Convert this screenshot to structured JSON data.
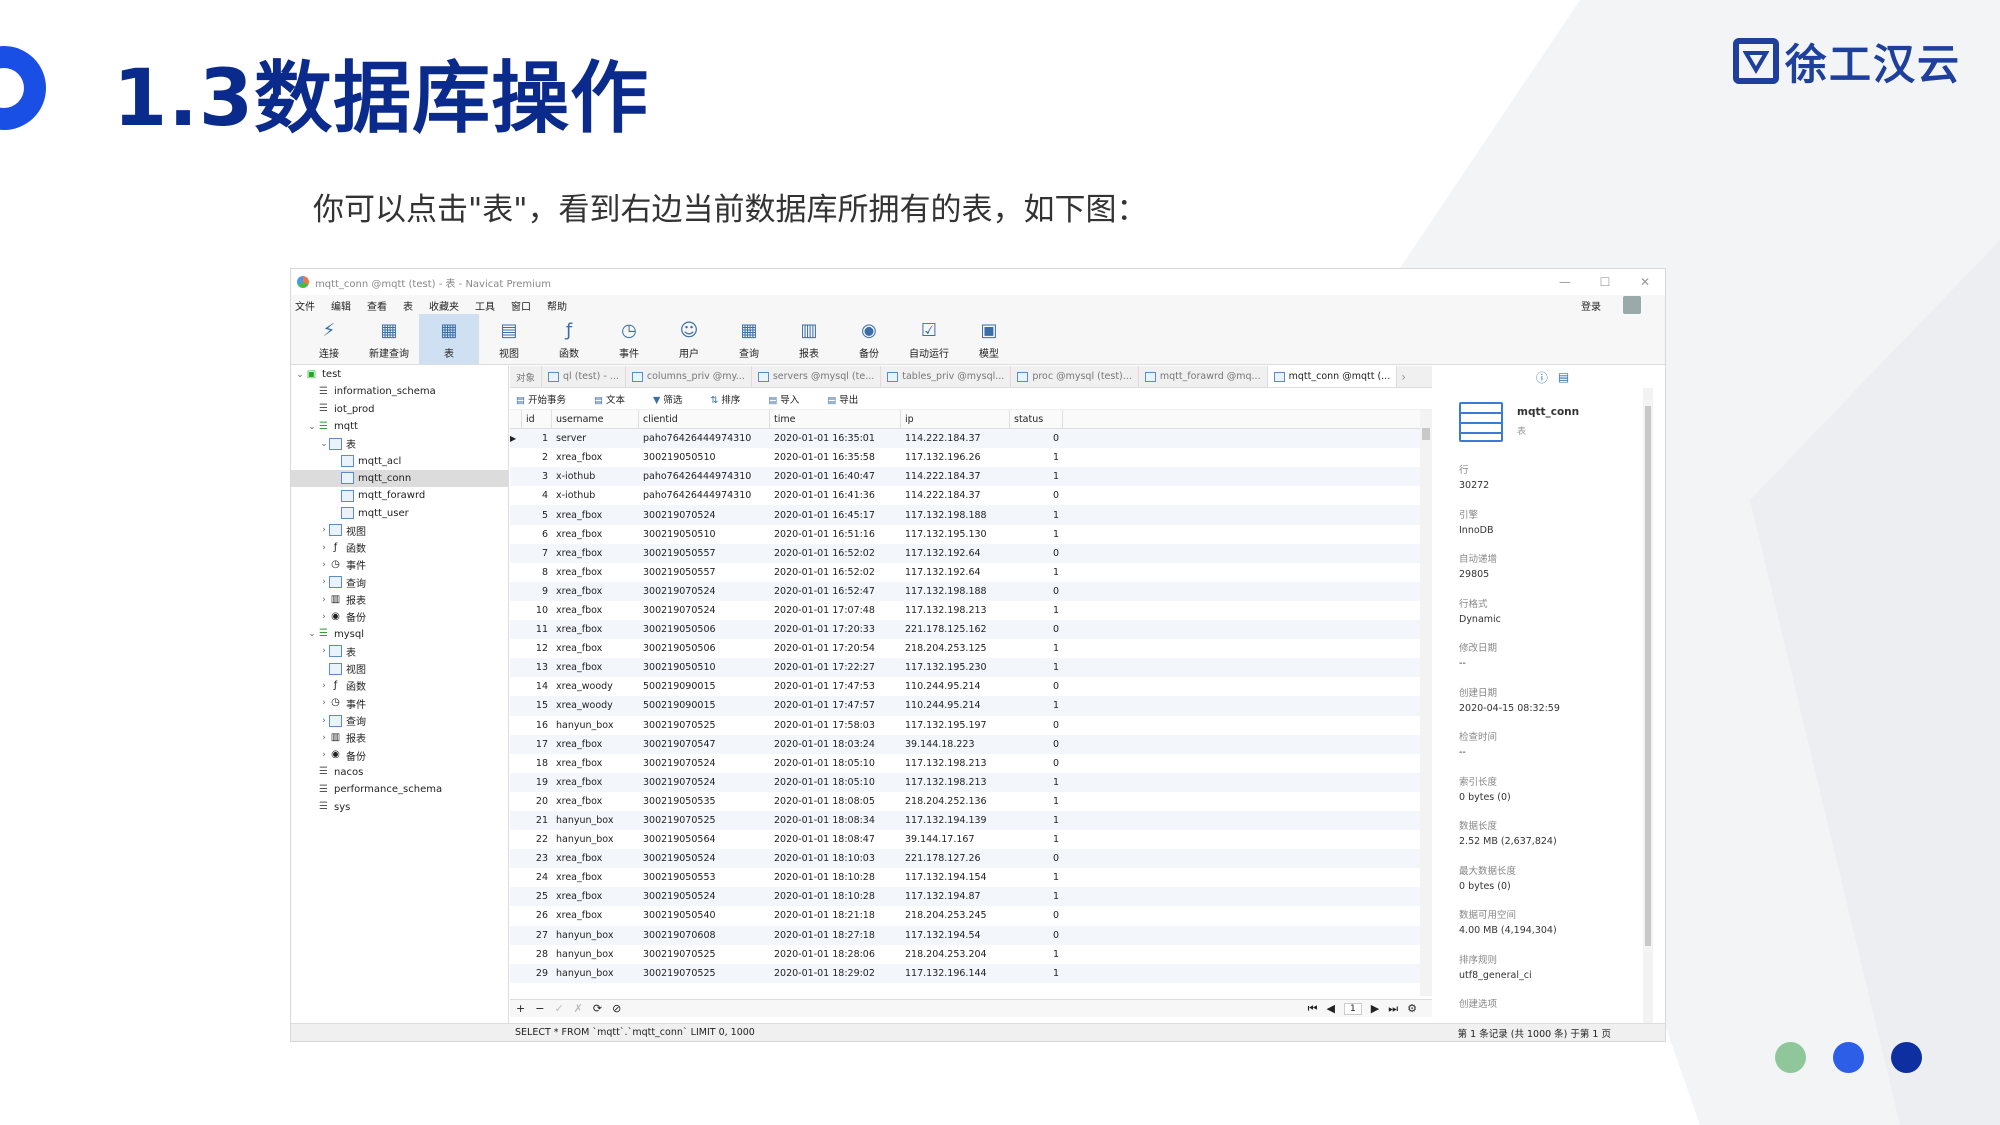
{
  "slide": {
    "title": "1.3数据库操作",
    "subtitle": "你可以点击\"表\"，看到右边当前数据库所拥有的表，如下图：",
    "logo_text": "徐工汉云",
    "colors": {
      "title": "#0a2a8c",
      "accent": "#1a4fe6",
      "dot1": "#8fc79b",
      "dot2": "#2c5ee8",
      "dot3": "#0d2fa0"
    }
  },
  "window": {
    "title": "mqtt_conn @mqtt (test) - 表 - Navicat Premium",
    "minimize": "—",
    "maximize": "☐",
    "close": "✕",
    "menu": [
      "文件",
      "编辑",
      "查看",
      "表",
      "收藏夹",
      "工具",
      "窗口",
      "帮助"
    ],
    "login": "登录",
    "toolbar": [
      {
        "label": "连接",
        "icon": "connection-icon"
      },
      {
        "label": "新建查询",
        "icon": "new-query-icon"
      },
      {
        "label": "表",
        "icon": "table-icon",
        "active": true
      },
      {
        "label": "视图",
        "icon": "view-icon"
      },
      {
        "label": "函数",
        "icon": "function-icon"
      },
      {
        "label": "事件",
        "icon": "event-icon"
      },
      {
        "label": "用户",
        "icon": "user-icon"
      },
      {
        "label": "查询",
        "icon": "query-icon"
      },
      {
        "label": "报表",
        "icon": "report-icon"
      },
      {
        "label": "备份",
        "icon": "backup-icon"
      },
      {
        "label": "自动运行",
        "icon": "automation-icon"
      },
      {
        "label": "模型",
        "icon": "model-icon"
      }
    ]
  },
  "tree": [
    {
      "label": "test",
      "level": 0,
      "twist": "v",
      "type": "conn"
    },
    {
      "label": "information_schema",
      "level": 1,
      "twist": "",
      "type": "db"
    },
    {
      "label": "iot_prod",
      "level": 1,
      "twist": "",
      "type": "db"
    },
    {
      "label": "mqtt",
      "level": 1,
      "twist": "v",
      "type": "dbg"
    },
    {
      "label": "表",
      "level": 2,
      "twist": "v",
      "type": "tbl"
    },
    {
      "label": "mqtt_acl",
      "level": 3,
      "twist": "",
      "type": "tbl"
    },
    {
      "label": "mqtt_conn",
      "level": 3,
      "twist": "",
      "type": "tbl",
      "selected": true
    },
    {
      "label": "mqtt_forawrd",
      "level": 3,
      "twist": "",
      "type": "tbl"
    },
    {
      "label": "mqtt_user",
      "level": 3,
      "twist": "",
      "type": "tbl"
    },
    {
      "label": "视图",
      "level": 2,
      "twist": ">",
      "type": "tbl"
    },
    {
      "label": "函数",
      "level": 2,
      "twist": ">",
      "type": "fx"
    },
    {
      "label": "事件",
      "level": 2,
      "twist": ">",
      "type": "ev"
    },
    {
      "label": "查询",
      "level": 2,
      "twist": ">",
      "type": "tbl"
    },
    {
      "label": "报表",
      "level": 2,
      "twist": ">",
      "type": "rp"
    },
    {
      "label": "备份",
      "level": 2,
      "twist": ">",
      "type": "bk"
    },
    {
      "label": "mysql",
      "level": 1,
      "twist": "v",
      "type": "dbg"
    },
    {
      "label": "表",
      "level": 2,
      "twist": ">",
      "type": "tbl"
    },
    {
      "label": "视图",
      "level": 2,
      "twist": "",
      "type": "tbl"
    },
    {
      "label": "函数",
      "level": 2,
      "twist": ">",
      "type": "fx"
    },
    {
      "label": "事件",
      "level": 2,
      "twist": ">",
      "type": "ev"
    },
    {
      "label": "查询",
      "level": 2,
      "twist": ">",
      "type": "tbl"
    },
    {
      "label": "报表",
      "level": 2,
      "twist": ">",
      "type": "rp"
    },
    {
      "label": "备份",
      "level": 2,
      "twist": ">",
      "type": "bk"
    },
    {
      "label": "nacos",
      "level": 1,
      "twist": "",
      "type": "db"
    },
    {
      "label": "performance_schema",
      "level": 1,
      "twist": "",
      "type": "db"
    },
    {
      "label": "sys",
      "level": 1,
      "twist": "",
      "type": "db"
    }
  ],
  "tabs": [
    {
      "label": "对象",
      "active": false
    },
    {
      "label": "ql (test) - ...",
      "active": false
    },
    {
      "label": "columns_priv @my...",
      "active": false
    },
    {
      "label": "servers @mysql (te...",
      "active": false
    },
    {
      "label": "tables_priv @mysql...",
      "active": false
    },
    {
      "label": "proc @mysql (test)...",
      "active": false
    },
    {
      "label": "mqtt_forawrd @mq...",
      "active": false
    },
    {
      "label": "mqtt_conn @mqtt (...",
      "active": true
    }
  ],
  "subtoolbar": [
    "开始事务",
    "文本",
    "筛选",
    "排序",
    "导入",
    "导出"
  ],
  "columns": [
    "id",
    "username",
    "clientid",
    "time",
    "ip",
    "status"
  ],
  "rows": [
    [
      "1",
      "server",
      "paho76426444974310",
      "2020-01-01 16:35:01",
      "114.222.184.37",
      "0"
    ],
    [
      "2",
      "xrea_fbox",
      "300219050510",
      "2020-01-01 16:35:58",
      "117.132.196.26",
      "1"
    ],
    [
      "3",
      "x-iothub",
      "paho76426444974310",
      "2020-01-01 16:40:47",
      "114.222.184.37",
      "1"
    ],
    [
      "4",
      "x-iothub",
      "paho76426444974310",
      "2020-01-01 16:41:36",
      "114.222.184.37",
      "0"
    ],
    [
      "5",
      "xrea_fbox",
      "300219070524",
      "2020-01-01 16:45:17",
      "117.132.198.188",
      "1"
    ],
    [
      "6",
      "xrea_fbox",
      "300219050510",
      "2020-01-01 16:51:16",
      "117.132.195.130",
      "1"
    ],
    [
      "7",
      "xrea_fbox",
      "300219050557",
      "2020-01-01 16:52:02",
      "117.132.192.64",
      "0"
    ],
    [
      "8",
      "xrea_fbox",
      "300219050557",
      "2020-01-01 16:52:02",
      "117.132.192.64",
      "1"
    ],
    [
      "9",
      "xrea_fbox",
      "300219070524",
      "2020-01-01 16:52:47",
      "117.132.198.188",
      "0"
    ],
    [
      "10",
      "xrea_fbox",
      "300219070524",
      "2020-01-01 17:07:48",
      "117.132.198.213",
      "1"
    ],
    [
      "11",
      "xrea_fbox",
      "300219050506",
      "2020-01-01 17:20:33",
      "221.178.125.162",
      "0"
    ],
    [
      "12",
      "xrea_fbox",
      "300219050506",
      "2020-01-01 17:20:54",
      "218.204.253.125",
      "1"
    ],
    [
      "13",
      "xrea_fbox",
      "300219050510",
      "2020-01-01 17:22:27",
      "117.132.195.230",
      "1"
    ],
    [
      "14",
      "xrea_woody",
      "500219090015",
      "2020-01-01 17:47:53",
      "110.244.95.214",
      "0"
    ],
    [
      "15",
      "xrea_woody",
      "500219090015",
      "2020-01-01 17:47:57",
      "110.244.95.214",
      "1"
    ],
    [
      "16",
      "hanyun_box",
      "300219070525",
      "2020-01-01 17:58:03",
      "117.132.195.197",
      "0"
    ],
    [
      "17",
      "xrea_fbox",
      "300219070547",
      "2020-01-01 18:03:24",
      "39.144.18.223",
      "0"
    ],
    [
      "18",
      "xrea_fbox",
      "300219070524",
      "2020-01-01 18:05:10",
      "117.132.198.213",
      "0"
    ],
    [
      "19",
      "xrea_fbox",
      "300219070524",
      "2020-01-01 18:05:10",
      "117.132.198.213",
      "1"
    ],
    [
      "20",
      "xrea_fbox",
      "300219050535",
      "2020-01-01 18:08:05",
      "218.204.252.136",
      "1"
    ],
    [
      "21",
      "hanyun_box",
      "300219070525",
      "2020-01-01 18:08:34",
      "117.132.194.139",
      "1"
    ],
    [
      "22",
      "hanyun_box",
      "300219050564",
      "2020-01-01 18:08:47",
      "39.144.17.167",
      "1"
    ],
    [
      "23",
      "xrea_fbox",
      "300219050524",
      "2020-01-01 18:10:03",
      "221.178.127.26",
      "0"
    ],
    [
      "24",
      "xrea_fbox",
      "300219050553",
      "2020-01-01 18:10:28",
      "117.132.194.154",
      "1"
    ],
    [
      "25",
      "xrea_fbox",
      "300219050524",
      "2020-01-01 18:10:28",
      "117.132.194.87",
      "1"
    ],
    [
      "26",
      "xrea_fbox",
      "300219050540",
      "2020-01-01 18:21:18",
      "218.204.253.245",
      "0"
    ],
    [
      "27",
      "hanyun_box",
      "300219070608",
      "2020-01-01 18:27:18",
      "117.132.194.54",
      "0"
    ],
    [
      "28",
      "hanyun_box",
      "300219070525",
      "2020-01-01 18:28:06",
      "218.204.253.204",
      "1"
    ],
    [
      "29",
      "hanyun_box",
      "300219070525",
      "2020-01-01 18:29:02",
      "117.132.196.144",
      "1"
    ]
  ],
  "navbar": {
    "add": "+",
    "remove": "−",
    "apply": "✓",
    "discard": "✗",
    "refresh": "⟳",
    "stop": "⊘",
    "first": "⏮",
    "prev": "◀",
    "page": "1",
    "next": "▶",
    "last": "⏭",
    "settings": "⚙"
  },
  "status": {
    "sql": "SELECT * FROM `mqtt`.`mqtt_conn` LIMIT 0, 1000",
    "records": "第 1 条记录 (共 1000 条) 于第 1 页"
  },
  "info": {
    "name": "mqtt_conn",
    "type": "表",
    "props": [
      {
        "label": "行",
        "value": "30272"
      },
      {
        "label": "引擎",
        "value": "InnoDB"
      },
      {
        "label": "自动递增",
        "value": "29805"
      },
      {
        "label": "行格式",
        "value": "Dynamic"
      },
      {
        "label": "修改日期",
        "value": "--"
      },
      {
        "label": "创建日期",
        "value": "2020-04-15 08:32:59"
      },
      {
        "label": "检查时间",
        "value": "--"
      },
      {
        "label": "索引长度",
        "value": "0 bytes (0)"
      },
      {
        "label": "数据长度",
        "value": "2.52 MB (2,637,824)"
      },
      {
        "label": "最大数据长度",
        "value": "0 bytes (0)"
      },
      {
        "label": "数据可用空间",
        "value": "4.00 MB (4,194,304)"
      },
      {
        "label": "排序规则",
        "value": "utf8_general_ci"
      },
      {
        "label": "创建选项",
        "value": ""
      }
    ]
  }
}
